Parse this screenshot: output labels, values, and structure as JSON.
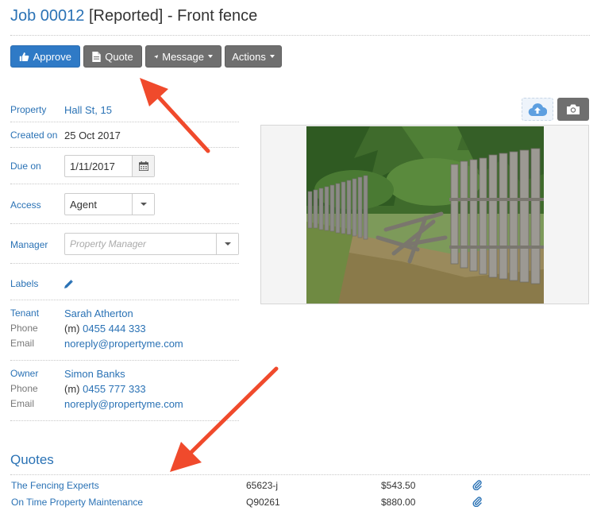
{
  "title": {
    "job": "Job 00012",
    "rest": " [Reported] - Front fence"
  },
  "toolbar": {
    "approve_label": "Approve",
    "quote_label": "Quote",
    "message_label": "Message",
    "actions_label": "Actions"
  },
  "details": {
    "property_label": "Property",
    "property_value": "Hall St, 15",
    "created_label": "Created on",
    "created_value": "25 Oct 2017",
    "due_label": "Due on",
    "due_value": "1/11/2017",
    "access_label": "Access",
    "access_value": "Agent",
    "manager_label": "Manager",
    "manager_placeholder": "Property Manager",
    "labels_label": "Labels"
  },
  "tenant": {
    "label": "Tenant",
    "name": "Sarah Atherton",
    "phone_label": "Phone",
    "phone_prefix": "(m)",
    "phone": "0455 444 333",
    "email_label": "Email",
    "email": "noreply@propertyme.com"
  },
  "owner": {
    "label": "Owner",
    "name": "Simon Banks",
    "phone_label": "Phone",
    "phone_prefix": "(m)",
    "phone": "0455 777 333",
    "email_label": "Email",
    "email": "noreply@propertyme.com"
  },
  "quotes": {
    "title": "Quotes",
    "rows": [
      {
        "name": "The Fencing Experts",
        "ref": "65623-j",
        "amount": "$543.50"
      },
      {
        "name": "On Time Property Maintenance",
        "ref": "Q90261",
        "amount": "$880.00"
      }
    ]
  },
  "colors": {
    "link": "#2a72b5",
    "primary_button": "#2f7ac6",
    "dark_button": "#6f6f6f",
    "annotation_arrow": "#f04a2c"
  },
  "icons": [
    "thumbs-up-icon",
    "document-icon",
    "paper-plane-icon",
    "calendar-icon",
    "pencil-icon",
    "cloud-upload-icon",
    "camera-icon",
    "paperclip-icon"
  ]
}
